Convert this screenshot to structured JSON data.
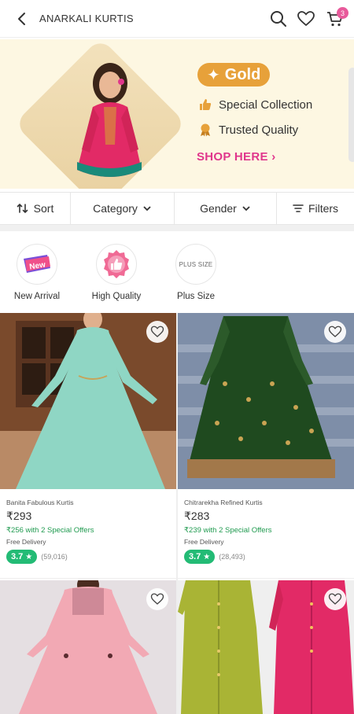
{
  "header": {
    "title": "ANARKALI KURTIS",
    "cart_count": "3",
    "icons": [
      "back-arrow-icon",
      "search-icon",
      "heart-icon",
      "cart-icon"
    ]
  },
  "banner": {
    "badge": "Gold",
    "features": [
      "Special Collection",
      "Trusted Quality"
    ],
    "cta": "SHOP HERE",
    "colors": {
      "background": "#fdf7e2",
      "gold": "#e7a13a",
      "cta": "#e0368c"
    }
  },
  "sortbar": {
    "sort": "Sort",
    "category": "Category",
    "gender": "Gender",
    "filters": "Filters"
  },
  "chips": [
    {
      "label": "New Arrival",
      "icon_text": "New"
    },
    {
      "label": "High Quality",
      "icon_text": ""
    },
    {
      "label": "Plus Size",
      "icon_text": "PLUS SIZE"
    }
  ],
  "products": [
    {
      "name": "Banita Fabulous Kurtis",
      "price": "₹293",
      "offer": "₹256 with 2 Special Offers",
      "delivery": "Free Delivery",
      "rating": "3.7",
      "reviews": "(59,016)",
      "color": "#8fd6c4"
    },
    {
      "name": "Chitrarekha Refined Kurtis",
      "price": "₹283",
      "offer": "₹239 with 2 Special Offers",
      "delivery": "Free Delivery",
      "rating": "3.7",
      "reviews": "(28,493)",
      "color": "#1f4a1f"
    },
    {
      "name": "",
      "color": "#f2a9b4"
    },
    {
      "name": "",
      "color": "#a9b435"
    }
  ]
}
